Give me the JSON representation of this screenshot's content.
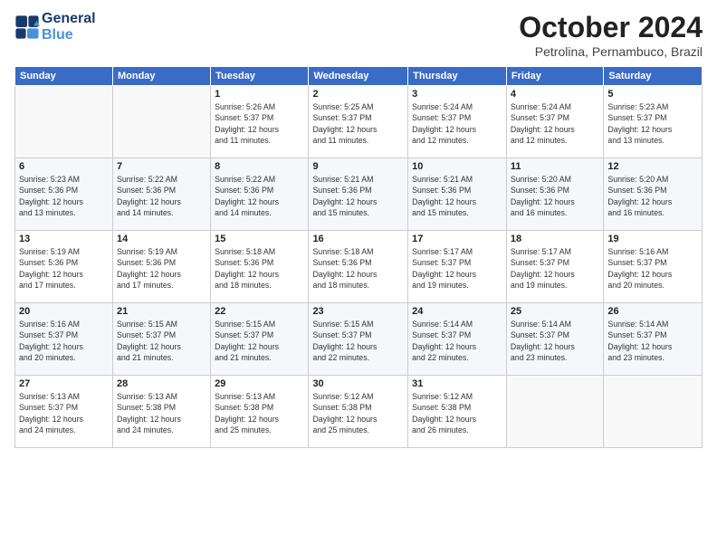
{
  "logo": {
    "line1": "General",
    "line2": "Blue",
    "icon_color": "#4a90d9"
  },
  "title": "October 2024",
  "location": "Petrolina, Pernambuco, Brazil",
  "days_of_week": [
    "Sunday",
    "Monday",
    "Tuesday",
    "Wednesday",
    "Thursday",
    "Friday",
    "Saturday"
  ],
  "weeks": [
    [
      {
        "day": "",
        "content": ""
      },
      {
        "day": "",
        "content": ""
      },
      {
        "day": "1",
        "content": "Sunrise: 5:26 AM\nSunset: 5:37 PM\nDaylight: 12 hours\nand 11 minutes."
      },
      {
        "day": "2",
        "content": "Sunrise: 5:25 AM\nSunset: 5:37 PM\nDaylight: 12 hours\nand 11 minutes."
      },
      {
        "day": "3",
        "content": "Sunrise: 5:24 AM\nSunset: 5:37 PM\nDaylight: 12 hours\nand 12 minutes."
      },
      {
        "day": "4",
        "content": "Sunrise: 5:24 AM\nSunset: 5:37 PM\nDaylight: 12 hours\nand 12 minutes."
      },
      {
        "day": "5",
        "content": "Sunrise: 5:23 AM\nSunset: 5:37 PM\nDaylight: 12 hours\nand 13 minutes."
      }
    ],
    [
      {
        "day": "6",
        "content": "Sunrise: 5:23 AM\nSunset: 5:36 PM\nDaylight: 12 hours\nand 13 minutes."
      },
      {
        "day": "7",
        "content": "Sunrise: 5:22 AM\nSunset: 5:36 PM\nDaylight: 12 hours\nand 14 minutes."
      },
      {
        "day": "8",
        "content": "Sunrise: 5:22 AM\nSunset: 5:36 PM\nDaylight: 12 hours\nand 14 minutes."
      },
      {
        "day": "9",
        "content": "Sunrise: 5:21 AM\nSunset: 5:36 PM\nDaylight: 12 hours\nand 15 minutes."
      },
      {
        "day": "10",
        "content": "Sunrise: 5:21 AM\nSunset: 5:36 PM\nDaylight: 12 hours\nand 15 minutes."
      },
      {
        "day": "11",
        "content": "Sunrise: 5:20 AM\nSunset: 5:36 PM\nDaylight: 12 hours\nand 16 minutes."
      },
      {
        "day": "12",
        "content": "Sunrise: 5:20 AM\nSunset: 5:36 PM\nDaylight: 12 hours\nand 16 minutes."
      }
    ],
    [
      {
        "day": "13",
        "content": "Sunrise: 5:19 AM\nSunset: 5:36 PM\nDaylight: 12 hours\nand 17 minutes."
      },
      {
        "day": "14",
        "content": "Sunrise: 5:19 AM\nSunset: 5:36 PM\nDaylight: 12 hours\nand 17 minutes."
      },
      {
        "day": "15",
        "content": "Sunrise: 5:18 AM\nSunset: 5:36 PM\nDaylight: 12 hours\nand 18 minutes."
      },
      {
        "day": "16",
        "content": "Sunrise: 5:18 AM\nSunset: 5:36 PM\nDaylight: 12 hours\nand 18 minutes."
      },
      {
        "day": "17",
        "content": "Sunrise: 5:17 AM\nSunset: 5:37 PM\nDaylight: 12 hours\nand 19 minutes."
      },
      {
        "day": "18",
        "content": "Sunrise: 5:17 AM\nSunset: 5:37 PM\nDaylight: 12 hours\nand 19 minutes."
      },
      {
        "day": "19",
        "content": "Sunrise: 5:16 AM\nSunset: 5:37 PM\nDaylight: 12 hours\nand 20 minutes."
      }
    ],
    [
      {
        "day": "20",
        "content": "Sunrise: 5:16 AM\nSunset: 5:37 PM\nDaylight: 12 hours\nand 20 minutes."
      },
      {
        "day": "21",
        "content": "Sunrise: 5:15 AM\nSunset: 5:37 PM\nDaylight: 12 hours\nand 21 minutes."
      },
      {
        "day": "22",
        "content": "Sunrise: 5:15 AM\nSunset: 5:37 PM\nDaylight: 12 hours\nand 21 minutes."
      },
      {
        "day": "23",
        "content": "Sunrise: 5:15 AM\nSunset: 5:37 PM\nDaylight: 12 hours\nand 22 minutes."
      },
      {
        "day": "24",
        "content": "Sunrise: 5:14 AM\nSunset: 5:37 PM\nDaylight: 12 hours\nand 22 minutes."
      },
      {
        "day": "25",
        "content": "Sunrise: 5:14 AM\nSunset: 5:37 PM\nDaylight: 12 hours\nand 23 minutes."
      },
      {
        "day": "26",
        "content": "Sunrise: 5:14 AM\nSunset: 5:37 PM\nDaylight: 12 hours\nand 23 minutes."
      }
    ],
    [
      {
        "day": "27",
        "content": "Sunrise: 5:13 AM\nSunset: 5:37 PM\nDaylight: 12 hours\nand 24 minutes."
      },
      {
        "day": "28",
        "content": "Sunrise: 5:13 AM\nSunset: 5:38 PM\nDaylight: 12 hours\nand 24 minutes."
      },
      {
        "day": "29",
        "content": "Sunrise: 5:13 AM\nSunset: 5:38 PM\nDaylight: 12 hours\nand 25 minutes."
      },
      {
        "day": "30",
        "content": "Sunrise: 5:12 AM\nSunset: 5:38 PM\nDaylight: 12 hours\nand 25 minutes."
      },
      {
        "day": "31",
        "content": "Sunrise: 5:12 AM\nSunset: 5:38 PM\nDaylight: 12 hours\nand 26 minutes."
      },
      {
        "day": "",
        "content": ""
      },
      {
        "day": "",
        "content": ""
      }
    ]
  ]
}
